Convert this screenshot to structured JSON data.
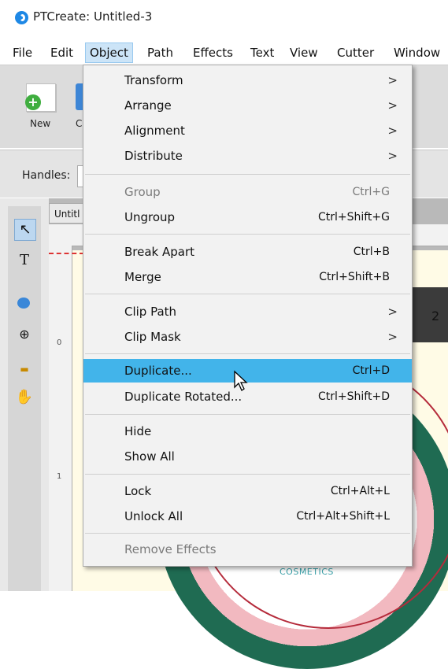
{
  "window": {
    "title": "PTCreate: Untitled-3",
    "app_icon": "ptcreate-logo-icon"
  },
  "menubar": {
    "items": [
      "File",
      "Edit",
      "Object",
      "Path",
      "Effects",
      "Text",
      "View",
      "Cutter",
      "Window"
    ],
    "active": "Object"
  },
  "toolbar": {
    "new_label": "New",
    "c_label": "C"
  },
  "optionbar": {
    "handles_label": "Handles:"
  },
  "document": {
    "tab_label": "Untitl",
    "cosmetics_text": "COSMETICS",
    "ruler_zero": "0",
    "ruler_one": "1",
    "num_two": "2"
  },
  "object_menu": {
    "items": [
      {
        "label": "Transform",
        "shortcut": "",
        "submenu": true,
        "enabled": true
      },
      {
        "label": "Arrange",
        "shortcut": "",
        "submenu": true,
        "enabled": true
      },
      {
        "label": "Alignment",
        "shortcut": "",
        "submenu": true,
        "enabled": true
      },
      {
        "label": "Distribute",
        "shortcut": "",
        "submenu": true,
        "enabled": true
      },
      {
        "label": "Group",
        "shortcut": "Ctrl+G",
        "submenu": false,
        "enabled": false
      },
      {
        "label": "Ungroup",
        "shortcut": "Ctrl+Shift+G",
        "submenu": false,
        "enabled": true
      },
      {
        "label": "Break Apart",
        "shortcut": "Ctrl+B",
        "submenu": false,
        "enabled": true
      },
      {
        "label": "Merge",
        "shortcut": "Ctrl+Shift+B",
        "submenu": false,
        "enabled": true
      },
      {
        "label": "Clip Path",
        "shortcut": "",
        "submenu": true,
        "enabled": true
      },
      {
        "label": "Clip Mask",
        "shortcut": "",
        "submenu": true,
        "enabled": true
      },
      {
        "label": "Duplicate...",
        "shortcut": "Ctrl+D",
        "submenu": false,
        "enabled": true,
        "highlighted": true
      },
      {
        "label": "Duplicate Rotated...",
        "shortcut": "Ctrl+Shift+D",
        "submenu": false,
        "enabled": true
      },
      {
        "label": "Hide",
        "shortcut": "",
        "submenu": false,
        "enabled": true
      },
      {
        "label": "Show All",
        "shortcut": "",
        "submenu": false,
        "enabled": true
      },
      {
        "label": "Lock",
        "shortcut": "Ctrl+Alt+L",
        "submenu": false,
        "enabled": true
      },
      {
        "label": "Unlock All",
        "shortcut": "Ctrl+Alt+Shift+L",
        "submenu": false,
        "enabled": true
      },
      {
        "label": "Remove Effects",
        "shortcut": "",
        "submenu": false,
        "enabled": false
      }
    ],
    "submenu_arrow": ">"
  },
  "colors": {
    "highlight": "#42b4ea",
    "menu_bg": "#f2f2f2",
    "active_menu": "#cce4f7"
  }
}
